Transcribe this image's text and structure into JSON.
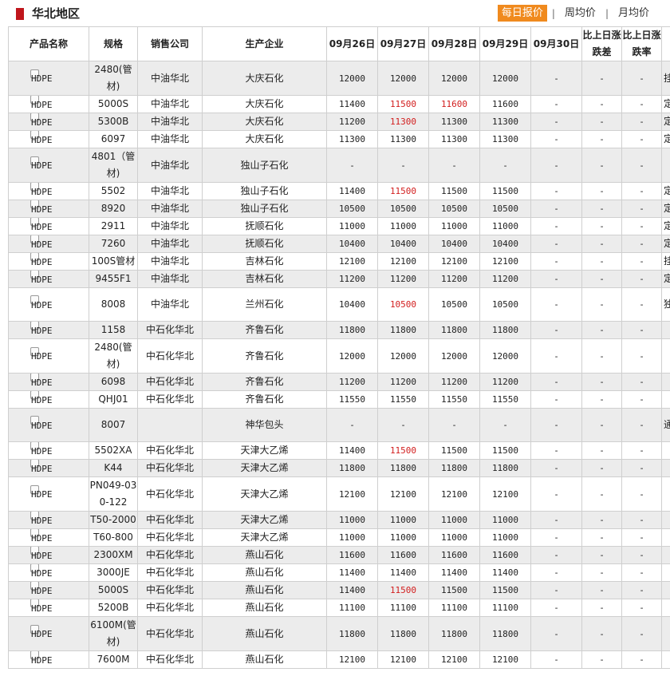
{
  "header": {
    "region_title": "华北地区",
    "tabs": [
      "每日报价",
      "周均价",
      "月均价"
    ],
    "active_tab": 0,
    "separator": "|"
  },
  "table": {
    "columns": [
      "产品名称",
      "规格",
      "销售公司",
      "生产企业",
      "09月26日",
      "09月27日",
      "09月28日",
      "09月29日",
      "09月30日",
      "比上日涨跌差",
      "比上日涨跌率",
      ""
    ],
    "rows": [
      {
        "product": "HDPE",
        "spec": "2480(管材)",
        "seller": "中油华北",
        "maker": "大庆石化",
        "d26": "12000",
        "d27": "12000",
        "d28": "12000",
        "d29": "12000",
        "d30": "-",
        "diff": "-",
        "rate": "-",
        "note": "挂",
        "tall": true,
        "shade": true
      },
      {
        "product": "HDPE",
        "spec": "5000S",
        "seller": "中油华北",
        "maker": "大庆石化",
        "d26": "11400",
        "d27": "11500",
        "d28": "11600",
        "d29": "11600",
        "d30": "-",
        "diff": "-",
        "rate": "-",
        "note": "定",
        "red": [
          "d27",
          "d28"
        ],
        "shade": false
      },
      {
        "product": "HDPE",
        "spec": "5300B",
        "seller": "中油华北",
        "maker": "大庆石化",
        "d26": "11200",
        "d27": "11300",
        "d28": "11300",
        "d29": "11300",
        "d30": "-",
        "diff": "-",
        "rate": "-",
        "note": "定",
        "red": [
          "d27"
        ],
        "shade": true
      },
      {
        "product": "HDPE",
        "spec": "6097",
        "seller": "中油华北",
        "maker": "大庆石化",
        "d26": "11300",
        "d27": "11300",
        "d28": "11300",
        "d29": "11300",
        "d30": "-",
        "diff": "-",
        "rate": "-",
        "note": "定",
        "shade": false
      },
      {
        "product": "HDPE",
        "spec": "4801（管材)",
        "seller": "中油华北",
        "maker": "独山子石化",
        "d26": "-",
        "d27": "-",
        "d28": "-",
        "d29": "-",
        "d30": "-",
        "diff": "-",
        "rate": "-",
        "note": "",
        "tall": true,
        "shade": true
      },
      {
        "product": "HDPE",
        "spec": "5502",
        "seller": "中油华北",
        "maker": "独山子石化",
        "d26": "11400",
        "d27": "11500",
        "d28": "11500",
        "d29": "11500",
        "d30": "-",
        "diff": "-",
        "rate": "-",
        "note": "定",
        "red": [
          "d27"
        ],
        "shade": false
      },
      {
        "product": "HDPE",
        "spec": "8920",
        "seller": "中油华北",
        "maker": "独山子石化",
        "d26": "10500",
        "d27": "10500",
        "d28": "10500",
        "d29": "10500",
        "d30": "-",
        "diff": "-",
        "rate": "-",
        "note": "定",
        "shade": true
      },
      {
        "product": "HDPE",
        "spec": "2911",
        "seller": "中油华北",
        "maker": "抚顺石化",
        "d26": "11000",
        "d27": "11000",
        "d28": "11000",
        "d29": "11000",
        "d30": "-",
        "diff": "-",
        "rate": "-",
        "note": "定",
        "shade": false
      },
      {
        "product": "HDPE",
        "spec": "7260",
        "seller": "中油华北",
        "maker": "抚顺石化",
        "d26": "10400",
        "d27": "10400",
        "d28": "10400",
        "d29": "10400",
        "d30": "-",
        "diff": "-",
        "rate": "-",
        "note": "定",
        "shade": true
      },
      {
        "product": "HDPE",
        "spec": "100S管材",
        "seller": "中油华北",
        "maker": "吉林石化",
        "d26": "12100",
        "d27": "12100",
        "d28": "12100",
        "d29": "12100",
        "d30": "-",
        "diff": "-",
        "rate": "-",
        "note": "挂",
        "shade": false
      },
      {
        "product": "HDPE",
        "spec": "9455F1",
        "seller": "中油华北",
        "maker": "吉林石化",
        "d26": "11200",
        "d27": "11200",
        "d28": "11200",
        "d29": "11200",
        "d30": "-",
        "diff": "-",
        "rate": "-",
        "note": "定",
        "shade": true
      },
      {
        "product": "HDPE",
        "spec": "8008",
        "seller": "中油华北",
        "maker": "兰州石化",
        "d26": "10400",
        "d27": "10500",
        "d28": "10500",
        "d29": "10500",
        "d30": "-",
        "diff": "-",
        "rate": "-",
        "note": "独",
        "red": [
          "d27"
        ],
        "tall": true,
        "shade": false
      },
      {
        "product": "HDPE",
        "spec": "1158",
        "seller": "中石化华北",
        "maker": "齐鲁石化",
        "d26": "11800",
        "d27": "11800",
        "d28": "11800",
        "d29": "11800",
        "d30": "-",
        "diff": "-",
        "rate": "-",
        "note": "",
        "shade": true
      },
      {
        "product": "HDPE",
        "spec": "2480(管材)",
        "seller": "中石化华北",
        "maker": "齐鲁石化",
        "d26": "12000",
        "d27": "12000",
        "d28": "12000",
        "d29": "12000",
        "d30": "-",
        "diff": "-",
        "rate": "-",
        "note": "",
        "tall": true,
        "shade": false
      },
      {
        "product": "HDPE",
        "spec": "6098",
        "seller": "中石化华北",
        "maker": "齐鲁石化",
        "d26": "11200",
        "d27": "11200",
        "d28": "11200",
        "d29": "11200",
        "d30": "-",
        "diff": "-",
        "rate": "-",
        "note": "",
        "shade": true
      },
      {
        "product": "HDPE",
        "spec": "QHJ01",
        "seller": "中石化华北",
        "maker": "齐鲁石化",
        "d26": "11550",
        "d27": "11550",
        "d28": "11550",
        "d29": "11550",
        "d30": "-",
        "diff": "-",
        "rate": "-",
        "note": "",
        "shade": false
      },
      {
        "product": "HDPE",
        "spec": "8007",
        "seller": "",
        "maker": "神华包头",
        "d26": "-",
        "d27": "-",
        "d28": "-",
        "d29": "-",
        "d30": "-",
        "diff": "-",
        "rate": "-",
        "note": "通",
        "tall": true,
        "shade": true
      },
      {
        "product": "HDPE",
        "spec": "5502XA",
        "seller": "中石化华北",
        "maker": "天津大乙烯",
        "d26": "11400",
        "d27": "11500",
        "d28": "11500",
        "d29": "11500",
        "d30": "-",
        "diff": "-",
        "rate": "-",
        "note": "",
        "red": [
          "d27"
        ],
        "shade": false
      },
      {
        "product": "HDPE",
        "spec": "K44",
        "seller": "中石化华北",
        "maker": "天津大乙烯",
        "d26": "11800",
        "d27": "11800",
        "d28": "11800",
        "d29": "11800",
        "d30": "-",
        "diff": "-",
        "rate": "-",
        "note": "",
        "shade": true
      },
      {
        "product": "HDPE",
        "spec": "PN049-030-122",
        "seller": "中石化华北",
        "maker": "天津大乙烯",
        "d26": "12100",
        "d27": "12100",
        "d28": "12100",
        "d29": "12100",
        "d30": "-",
        "diff": "-",
        "rate": "-",
        "note": "",
        "tall": true,
        "shade": false
      },
      {
        "product": "HDPE",
        "spec": "T50-2000",
        "seller": "中石化华北",
        "maker": "天津大乙烯",
        "d26": "11000",
        "d27": "11000",
        "d28": "11000",
        "d29": "11000",
        "d30": "-",
        "diff": "-",
        "rate": "-",
        "note": "",
        "shade": true
      },
      {
        "product": "HDPE",
        "spec": "T60-800",
        "seller": "中石化华北",
        "maker": "天津大乙烯",
        "d26": "11000",
        "d27": "11000",
        "d28": "11000",
        "d29": "11000",
        "d30": "-",
        "diff": "-",
        "rate": "-",
        "note": "",
        "shade": false
      },
      {
        "product": "HDPE",
        "spec": "2300XM",
        "seller": "中石化华北",
        "maker": "燕山石化",
        "d26": "11600",
        "d27": "11600",
        "d28": "11600",
        "d29": "11600",
        "d30": "-",
        "diff": "-",
        "rate": "-",
        "note": "",
        "shade": true
      },
      {
        "product": "HDPE",
        "spec": "3000JE",
        "seller": "中石化华北",
        "maker": "燕山石化",
        "d26": "11400",
        "d27": "11400",
        "d28": "11400",
        "d29": "11400",
        "d30": "-",
        "diff": "-",
        "rate": "-",
        "note": "",
        "shade": false
      },
      {
        "product": "HDPE",
        "spec": "5000S",
        "seller": "中石化华北",
        "maker": "燕山石化",
        "d26": "11400",
        "d27": "11500",
        "d28": "11500",
        "d29": "11500",
        "d30": "-",
        "diff": "-",
        "rate": "-",
        "note": "",
        "red": [
          "d27"
        ],
        "shade": true
      },
      {
        "product": "HDPE",
        "spec": "5200B",
        "seller": "中石化华北",
        "maker": "燕山石化",
        "d26": "11100",
        "d27": "11100",
        "d28": "11100",
        "d29": "11100",
        "d30": "-",
        "diff": "-",
        "rate": "-",
        "note": "",
        "shade": false
      },
      {
        "product": "HDPE",
        "spec": "6100M(管材)",
        "seller": "中石化华北",
        "maker": "燕山石化",
        "d26": "11800",
        "d27": "11800",
        "d28": "11800",
        "d29": "11800",
        "d30": "-",
        "diff": "-",
        "rate": "-",
        "note": "",
        "tall": true,
        "shade": true
      },
      {
        "product": "HDPE",
        "spec": "7600M",
        "seller": "中石化华北",
        "maker": "燕山石化",
        "d26": "12100",
        "d27": "12100",
        "d28": "12100",
        "d29": "12100",
        "d30": "-",
        "diff": "-",
        "rate": "-",
        "note": "",
        "shade": false
      }
    ]
  }
}
